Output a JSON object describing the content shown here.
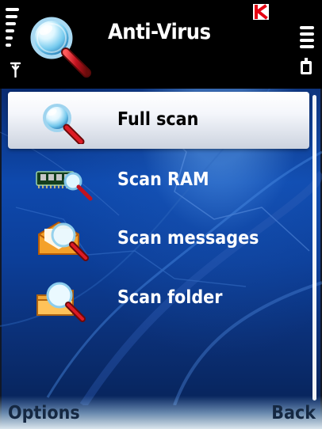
{
  "header": {
    "title": "Anti-Virus",
    "icon": "magnifier-icon",
    "brand_icon": "brand-k-icon",
    "signal_icon": "signal-strength-icon",
    "battery_icon": "battery-icon"
  },
  "menu": {
    "items": [
      {
        "label": "Full scan",
        "icon": "full-scan-icon",
        "selected": true
      },
      {
        "label": "Scan RAM",
        "icon": "scan-ram-icon",
        "selected": false
      },
      {
        "label": "Scan messages",
        "icon": "scan-messages-icon",
        "selected": false
      },
      {
        "label": "Scan folder",
        "icon": "scan-folder-icon",
        "selected": false
      }
    ]
  },
  "softkeys": {
    "left": "Options",
    "right": "Back"
  },
  "colors": {
    "selection_top": "#ffffff",
    "selection_bottom": "#ccd3df",
    "background_blue": "#0e49ad",
    "header_black": "#000000",
    "magnifier_handle": "#c1121f",
    "envelope_orange": "#f4a12a"
  }
}
